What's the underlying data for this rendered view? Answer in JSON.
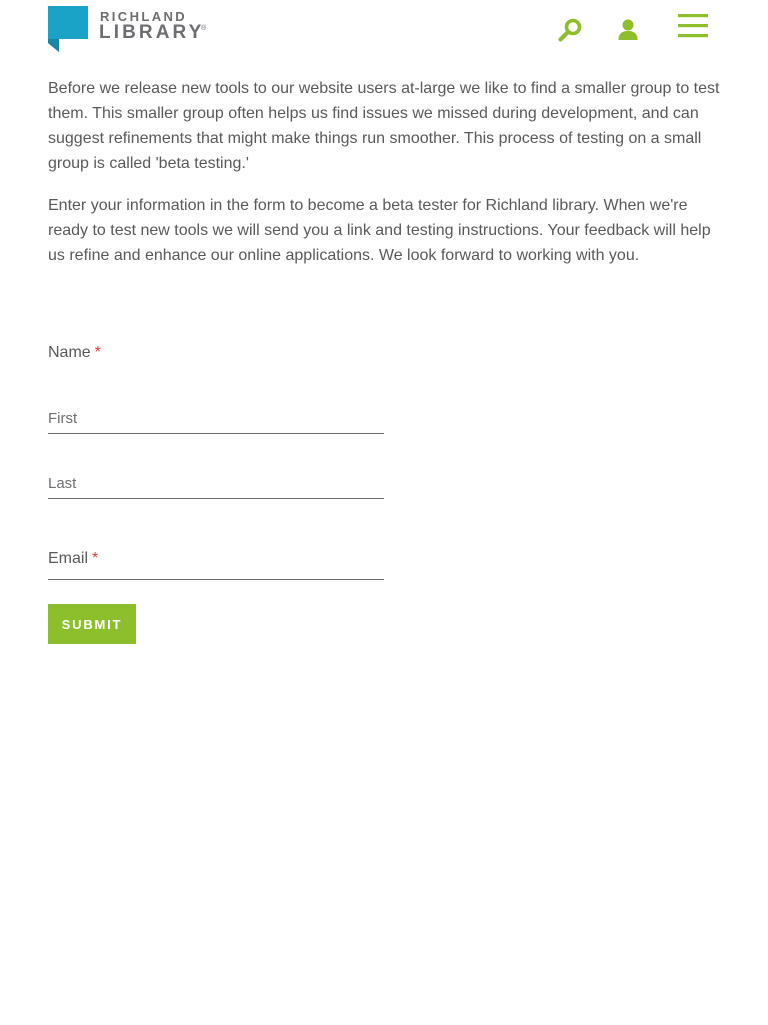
{
  "header": {
    "logo": {
      "line1": "RICHLAND",
      "line2": "LIBRARY",
      "registered": "®",
      "mark_color": "#1ba3c7",
      "mark_color_dark": "#1785a6"
    },
    "search_icon": "search-icon",
    "user_icon": "user-icon",
    "menu_icon": "hamburger-menu-icon",
    "icon_color": "#8dbf2c"
  },
  "intro": {
    "paragraph1": "Before we release new tools to our website users at-large we like to find a smaller group to test them. This smaller group often helps us find issues we missed during development, and can suggest refinements that might make things run smoother. This process of testing on a small group is called 'beta testing.'",
    "paragraph2": "Enter your information in the form to become a beta tester for Richland library. When we're ready to test new tools we will send you a link and testing instructions. Your feedback will help us refine and enhance our online applications. We look forward to working with you."
  },
  "form": {
    "name_label": "Name",
    "required_marker": "*",
    "first_placeholder": "First",
    "first_value": "",
    "last_placeholder": "Last",
    "last_value": "",
    "email_label": "Email",
    "email_value": "",
    "submit_label": "SUBMIT",
    "accent_color": "#8dbf2c",
    "required_color": "#e0373a"
  }
}
